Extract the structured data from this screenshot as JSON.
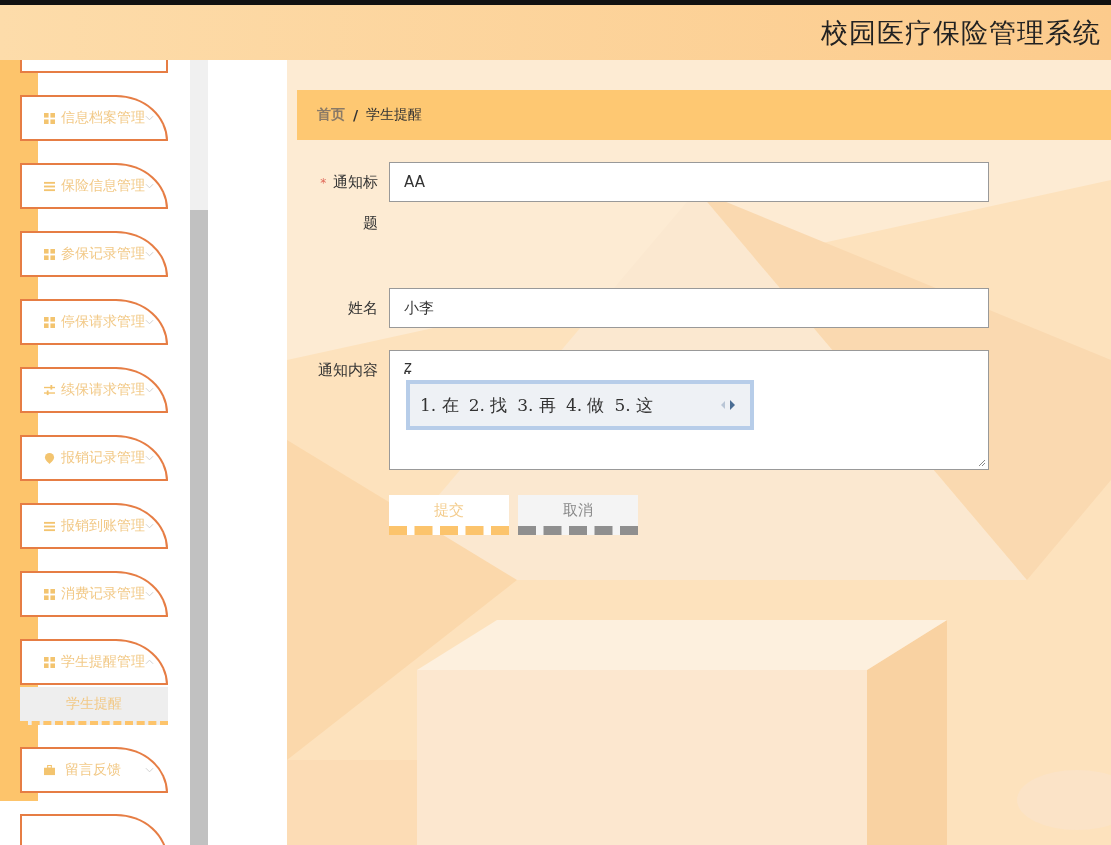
{
  "header": {
    "title": "校园医疗保险管理系统"
  },
  "sidebar": {
    "items": [
      {
        "label": "信息档案管理",
        "expanded": false
      },
      {
        "label": "保险信息管理",
        "expanded": false
      },
      {
        "label": "参保记录管理",
        "expanded": false
      },
      {
        "label": "停保请求管理",
        "expanded": false
      },
      {
        "label": "续保请求管理",
        "expanded": false
      },
      {
        "label": "报销记录管理",
        "expanded": false
      },
      {
        "label": "报销到账管理",
        "expanded": false
      },
      {
        "label": "消费记录管理",
        "expanded": false
      },
      {
        "label": "学生提醒管理",
        "expanded": true,
        "children": [
          {
            "label": "学生提醒",
            "selected": true
          }
        ]
      },
      {
        "label": "留言反馈",
        "expanded": false
      }
    ]
  },
  "breadcrumb": {
    "items": [
      "首页",
      "学生提醒"
    ],
    "separator": "/"
  },
  "form": {
    "required_mark": "*",
    "fields": [
      {
        "kind": "input",
        "label": "通知标题",
        "required": true,
        "value": "AA"
      },
      {
        "kind": "input",
        "label": "姓名",
        "required": false,
        "value": "小李"
      },
      {
        "kind": "textarea",
        "label": "通知内容",
        "required": false,
        "value": "z"
      }
    ],
    "ime": {
      "candidates": [
        "1. 在",
        "2. 找",
        "3. 再",
        "4. 做",
        "5. 这"
      ]
    },
    "buttons": [
      {
        "kind": "primary",
        "label": "提交"
      },
      {
        "kind": "cancel",
        "label": "取消"
      }
    ]
  }
}
